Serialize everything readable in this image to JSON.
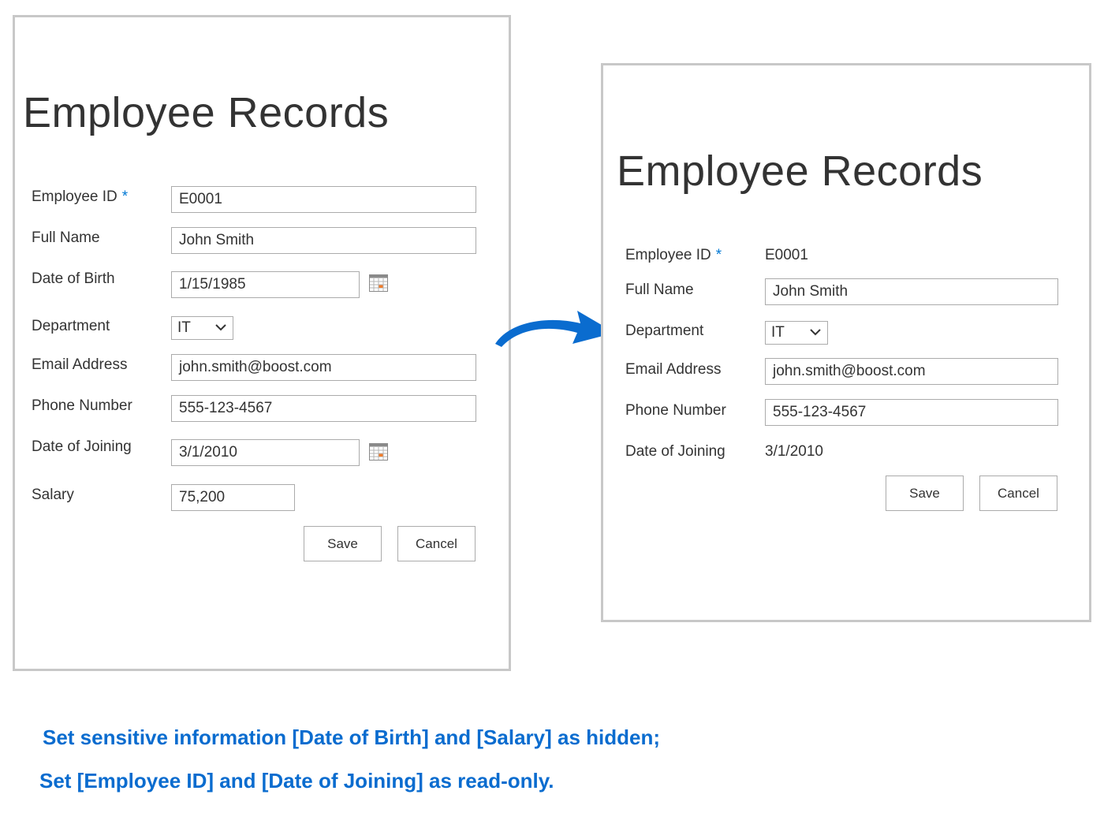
{
  "colors": {
    "accent": "#0078d4",
    "caption": "#0a6ccf",
    "border": "#ababab",
    "text": "#333333",
    "calendar_highlight": "#f07c2a"
  },
  "before_form": {
    "title": "Employee Records",
    "fields": {
      "employee_id": {
        "label": "Employee ID",
        "required_mark": "*",
        "value": "E0001"
      },
      "full_name": {
        "label": "Full Name",
        "value": "John Smith"
      },
      "date_of_birth": {
        "label": "Date of Birth",
        "value": "1/15/1985",
        "icon": "calendar-icon"
      },
      "department": {
        "label": "Department",
        "value": "IT",
        "icon": "chevron-down-icon"
      },
      "email": {
        "label": "Email Address",
        "value": "john.smith@boost.com"
      },
      "phone": {
        "label": "Phone Number",
        "value": "555-123-4567"
      },
      "date_of_joining": {
        "label": "Date of Joining",
        "value": "3/1/2010",
        "icon": "calendar-icon"
      },
      "salary": {
        "label": "Salary",
        "value": "75,200"
      }
    },
    "buttons": {
      "save": "Save",
      "cancel": "Cancel"
    }
  },
  "after_form": {
    "title": "Employee Records",
    "fields": {
      "employee_id": {
        "label": "Employee ID",
        "required_mark": "*",
        "value": "E0001"
      },
      "full_name": {
        "label": "Full Name",
        "value": "John Smith"
      },
      "department": {
        "label": "Department",
        "value": "IT",
        "icon": "chevron-down-icon"
      },
      "email": {
        "label": "Email Address",
        "value": "john.smith@boost.com"
      },
      "phone": {
        "label": "Phone Number",
        "value": "555-123-4567"
      },
      "date_of_joining": {
        "label": "Date of Joining",
        "value": "3/1/2010"
      }
    },
    "buttons": {
      "save": "Save",
      "cancel": "Cancel"
    }
  },
  "arrow_icon": "curved-arrow-right-icon",
  "captions": {
    "line1": "Set sensitive information [Date of Birth] and [Salary] as hidden;",
    "line2": "Set [Employee ID] and [Date of Joining] as read-only."
  }
}
